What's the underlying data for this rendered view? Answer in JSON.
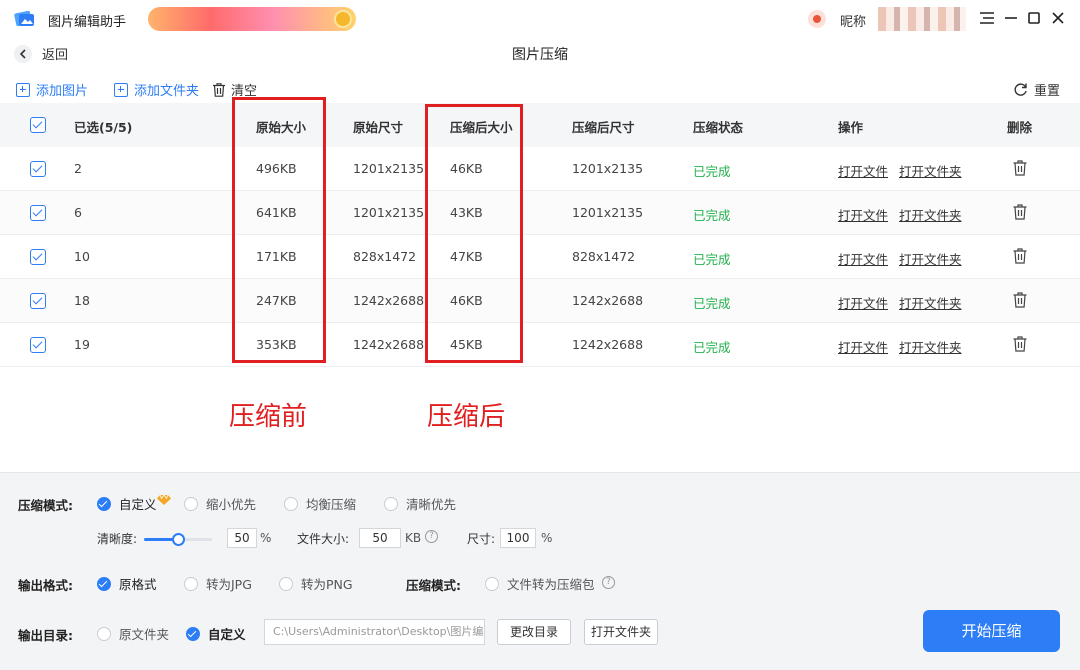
{
  "app": {
    "title": "图片编辑助手",
    "nickname_label": "昵称"
  },
  "header": {
    "back_label": "返回",
    "title": "图片压缩"
  },
  "toolbar": {
    "add_image": "添加图片",
    "add_folder": "添加文件夹",
    "clear": "清空",
    "reset": "重置"
  },
  "table": {
    "columns": [
      "已选(5/5)",
      "原始大小",
      "原始尺寸",
      "压缩后大小",
      "压缩后尺寸",
      "压缩状态",
      "操作",
      "删除"
    ],
    "rows": [
      {
        "name": "2",
        "orig_size": "496KB",
        "orig_dim": "1201x2135",
        "new_size": "46KB",
        "new_dim": "1201x2135",
        "status": "已完成",
        "open_file": "打开文件",
        "open_folder": "打开文件夹"
      },
      {
        "name": "6",
        "orig_size": "641KB",
        "orig_dim": "1201x2135",
        "new_size": "43KB",
        "new_dim": "1201x2135",
        "status": "已完成",
        "open_file": "打开文件",
        "open_folder": "打开文件夹"
      },
      {
        "name": "10",
        "orig_size": "171KB",
        "orig_dim": "828x1472",
        "new_size": "47KB",
        "new_dim": "828x1472",
        "status": "已完成",
        "open_file": "打开文件",
        "open_folder": "打开文件夹"
      },
      {
        "name": "18",
        "orig_size": "247KB",
        "orig_dim": "1242x2688",
        "new_size": "46KB",
        "new_dim": "1242x2688",
        "status": "已完成",
        "open_file": "打开文件",
        "open_folder": "打开文件夹"
      },
      {
        "name": "19",
        "orig_size": "353KB",
        "orig_dim": "1242x2688",
        "new_size": "45KB",
        "new_dim": "1242x2688",
        "status": "已完成",
        "open_file": "打开文件",
        "open_folder": "打开文件夹"
      }
    ]
  },
  "annotations": {
    "before": "压缩前",
    "after": "压缩后"
  },
  "settings": {
    "mode_label": "压缩模式:",
    "mode_options": [
      "自定义",
      "缩小优先",
      "均衡压缩",
      "清晰优先"
    ],
    "mode_selected": "自定义",
    "clarity_label": "清晰度:",
    "clarity_value": "50",
    "clarity_level": 0.5,
    "clarity_unit": "%",
    "filesize_label": "文件大小:",
    "filesize_value": "50",
    "filesize_unit": "KB",
    "dimension_label": "尺寸:",
    "dimension_value": "100",
    "dimension_unit": "%",
    "format_label": "输出格式:",
    "format_options": [
      "原格式",
      "转为JPG",
      "转为PNG"
    ],
    "format_selected": "原格式",
    "pack_label": "压缩模式:",
    "pack_option": "文件转为压缩包",
    "output_label": "输出目录:",
    "output_options": [
      "原文件夹",
      "自定义"
    ],
    "output_selected": "自定义",
    "output_path": "C:\\Users\\Administrator\\Desktop\\图片编辑",
    "change_dir": "更改目录",
    "open_folder": "打开文件夹",
    "start": "开始压缩"
  },
  "colors": {
    "accent": "#2d7df6",
    "done": "#22b14c",
    "annotation": "#e02020"
  }
}
